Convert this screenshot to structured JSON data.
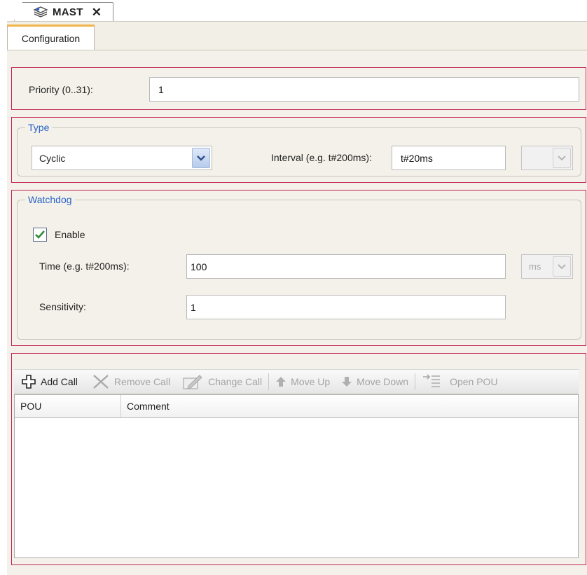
{
  "document_tab": {
    "title": "MAST",
    "icon": "task-stack-icon",
    "close_icon": "close-icon"
  },
  "editor_tabs": [
    {
      "label": "Configuration",
      "active": true
    }
  ],
  "priority": {
    "label": "Priority (0..31):",
    "value": "1"
  },
  "type_group": {
    "legend": "Type",
    "type_value": "Cyclic",
    "interval_label": "Interval (e.g. t#200ms):",
    "interval_value": "t#20ms",
    "interval_unit_value": ""
  },
  "watchdog_group": {
    "legend": "Watchdog",
    "enable_label": "Enable",
    "enable_checked": true,
    "time_label": "Time (e.g. t#200ms):",
    "time_value": "100",
    "time_unit": "ms",
    "sensitivity_label": "Sensitivity:",
    "sensitivity_value": "1"
  },
  "toolbar": {
    "add_call": "Add Call",
    "remove_call": "Remove Call",
    "change_call": "Change Call",
    "move_up": "Move Up",
    "move_down": "Move Down",
    "open_pou": "Open POU"
  },
  "table": {
    "columns": [
      "POU",
      "Comment"
    ],
    "rows": []
  },
  "colors": {
    "highlight_frame": "#c2254f",
    "legend_text": "#2a63c8",
    "tab_accent": "#f0b44a",
    "panel_bg": "#f3f1e9"
  }
}
